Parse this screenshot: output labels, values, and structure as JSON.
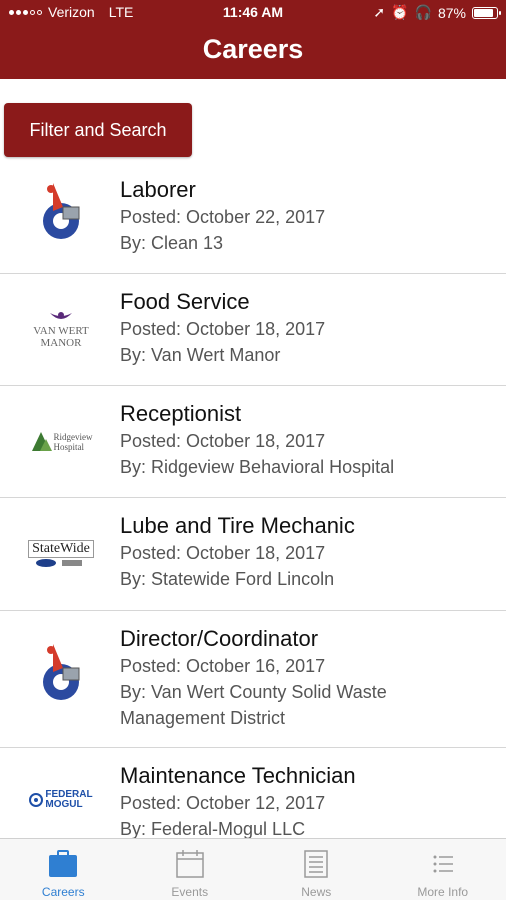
{
  "status_bar": {
    "carrier": "Verizon",
    "network": "LTE",
    "time": "11:46 AM",
    "battery": "87%",
    "battery_level": 0.87
  },
  "header": {
    "title": "Careers"
  },
  "filter_button": {
    "label": "Filter and Search"
  },
  "jobs": [
    {
      "title": "Laborer",
      "posted": "Posted: October 22, 2017",
      "by": "By: Clean 13",
      "logo": "clean13-logo"
    },
    {
      "title": "Food Service",
      "posted": "Posted: October 18, 2017",
      "by": "By: Van Wert Manor",
      "logo": "van-wert-manor-logo",
      "logo_text_1": "VAN WERT",
      "logo_text_2": "MANOR"
    },
    {
      "title": "Receptionist",
      "posted": "Posted: October 18, 2017",
      "by": "By: Ridgeview Behavioral Hospital",
      "logo": "ridgeview-logo",
      "logo_text_1": "Ridgeview",
      "logo_text_2": "Hospital"
    },
    {
      "title": "Lube and Tire Mechanic",
      "posted": "Posted: October 18, 2017",
      "by": "By: Statewide Ford Lincoln",
      "logo": "statewide-logo",
      "logo_text_1": "StateWide"
    },
    {
      "title": "Director/Coordinator",
      "posted": "Posted: October 16, 2017",
      "by": "By: Van Wert County Solid Waste Management District",
      "logo": "clean13-logo"
    },
    {
      "title": "Maintenance Technician",
      "posted": "Posted: October 12, 2017",
      "by": "By: Federal-Mogul LLC",
      "logo": "federal-mogul-logo",
      "logo_text_1": "FEDERAL",
      "logo_text_2": "MOGUL"
    }
  ],
  "tabs": [
    {
      "label": "Careers",
      "icon": "briefcase-icon",
      "active": true
    },
    {
      "label": "Events",
      "icon": "calendar-icon",
      "active": false
    },
    {
      "label": "News",
      "icon": "newspaper-icon",
      "active": false
    },
    {
      "label": "More Info",
      "icon": "list-icon",
      "active": false
    }
  ],
  "colors": {
    "brand": "#8b1a1a",
    "tab_active": "#2f7fd2",
    "tab_inactive": "#9a9a9a"
  }
}
